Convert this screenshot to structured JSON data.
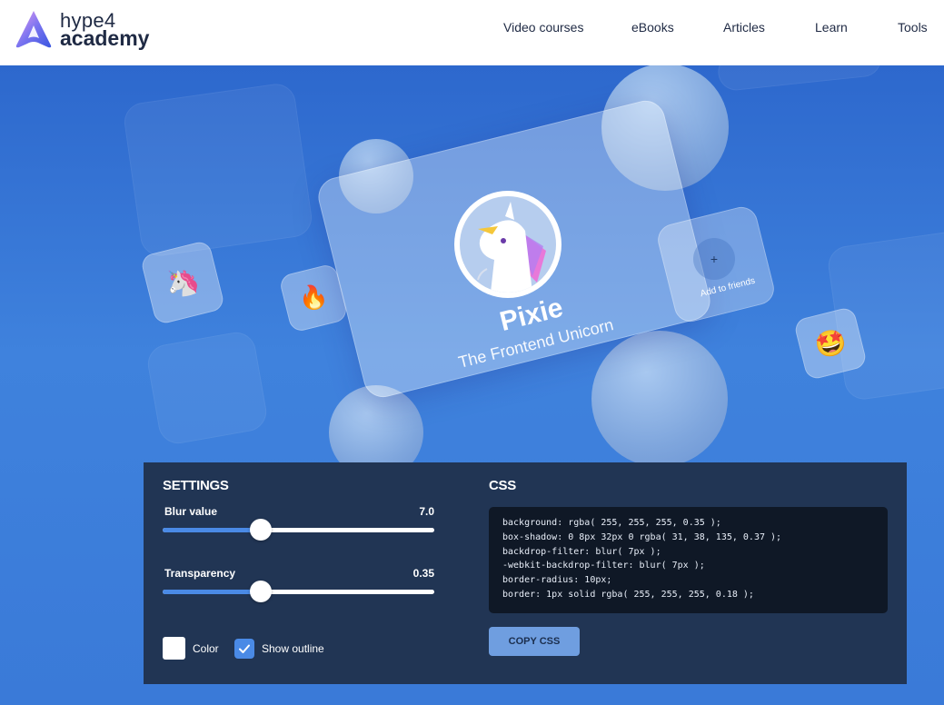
{
  "header": {
    "logo_line1": "hype4",
    "logo_line2": "academy",
    "nav": [
      "Video courses",
      "eBooks",
      "Articles",
      "Learn",
      "Tools"
    ]
  },
  "hero": {
    "card_title": "Pixie",
    "card_subtitle": "The Frontend Unicorn",
    "friend_plus": "+",
    "friend_label": "Add to friends",
    "emojis": [
      "🦄",
      "🔥",
      "🤩"
    ]
  },
  "settings": {
    "title": "SETTINGS",
    "blur": {
      "label": "Blur value",
      "value": "7.0",
      "fraction": 0.36
    },
    "transparency": {
      "label": "Transparency",
      "value": "0.35",
      "fraction": 0.36
    },
    "color_label": "Color",
    "outline_label": "Show outline",
    "outline_checked": true
  },
  "css": {
    "title": "CSS",
    "lines": [
      "background: rgba( 255, 255, 255, 0.35 );",
      "box-shadow: 0 8px 32px 0 rgba( 31, 38, 135, 0.37 );",
      "backdrop-filter: blur( 7px );",
      "-webkit-backdrop-filter: blur( 7px );",
      "border-radius: 10px;",
      "border: 1px solid rgba( 255, 255, 255, 0.18 );"
    ],
    "copy_label": "COPY CSS"
  },
  "colors": {
    "panel_bg": "#213554",
    "accent": "#4a8ae6",
    "brand_text": "#1f2a44"
  }
}
